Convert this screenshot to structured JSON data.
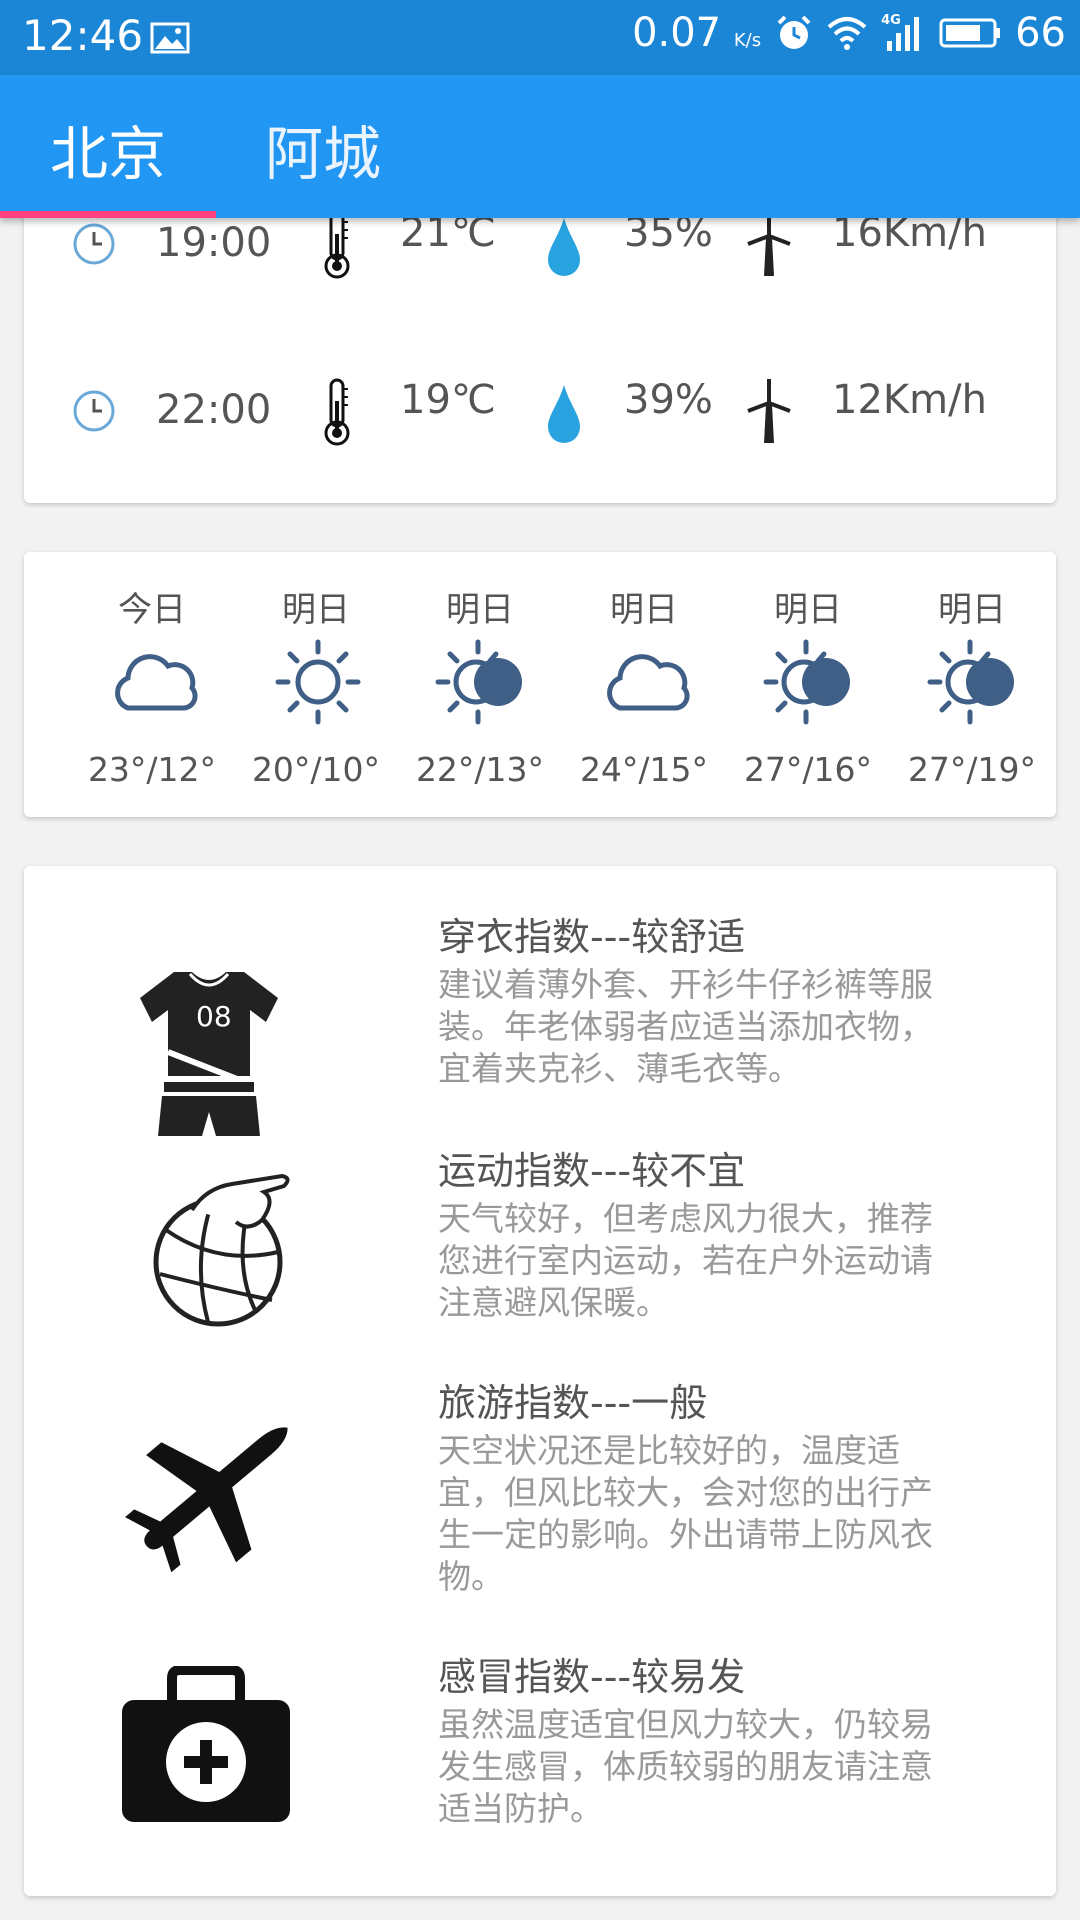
{
  "status_bar": {
    "time": "12:46",
    "net_speed": "0.07",
    "net_unit": "K/s",
    "signal": "4G",
    "battery": "66"
  },
  "tabs": [
    {
      "label": "北京",
      "selected": true
    },
    {
      "label": "阿城",
      "selected": false
    }
  ],
  "hourly": [
    {
      "time": "19:00",
      "temp": "21℃",
      "humidity": "35%",
      "wind": "16Km/h"
    },
    {
      "time": "22:00",
      "temp": "19℃",
      "humidity": "39%",
      "wind": "12Km/h"
    }
  ],
  "daily": [
    {
      "day": "今日",
      "icon": "cloudy-icon",
      "temp": "23°/12°"
    },
    {
      "day": "明日",
      "icon": "sunny-icon",
      "temp": "20°/10°"
    },
    {
      "day": "明日",
      "icon": "partly-cloudy-icon",
      "temp": "22°/13°"
    },
    {
      "day": "明日",
      "icon": "cloudy-icon",
      "temp": "24°/15°"
    },
    {
      "day": "明日",
      "icon": "partly-cloudy-icon",
      "temp": "27°/16°"
    },
    {
      "day": "明日",
      "icon": "partly-cloudy-icon",
      "temp": "27°/19°"
    }
  ],
  "suggestions": [
    {
      "icon": "clothing-icon",
      "title": "穿衣指数---较舒适",
      "lines": [
        "建议着薄外套、开衫牛仔衫裤等服",
        "装。年老体弱者应适当添加衣物，",
        "宜着夹克衫、薄毛衣等。"
      ]
    },
    {
      "icon": "sport-icon",
      "title": "运动指数---较不宜",
      "lines": [
        "天气较好，但考虑风力很大，推荐",
        "您进行室内运动，若在户外运动请",
        "注意避风保暖。"
      ]
    },
    {
      "icon": "travel-icon",
      "title": "旅游指数---一般",
      "lines": [
        "天空状况还是比较好的，温度适",
        "宜，但风比较大，会对您的出行产",
        "生一定的影响。外出请带上防风衣",
        "物。"
      ]
    },
    {
      "icon": "flu-icon",
      "title": "感冒指数---较易发",
      "lines": [
        "虽然温度适宜但风力较大，仍较易",
        "发生感冒，体质较弱的朋友请注意",
        "适当防护。"
      ]
    }
  ],
  "colors": {
    "status_bar": "#1b86d6",
    "app_bar": "#2196f3",
    "indicator": "#ff4081",
    "weather_icon": "#3f5f87",
    "drop": "#29a3e0"
  }
}
